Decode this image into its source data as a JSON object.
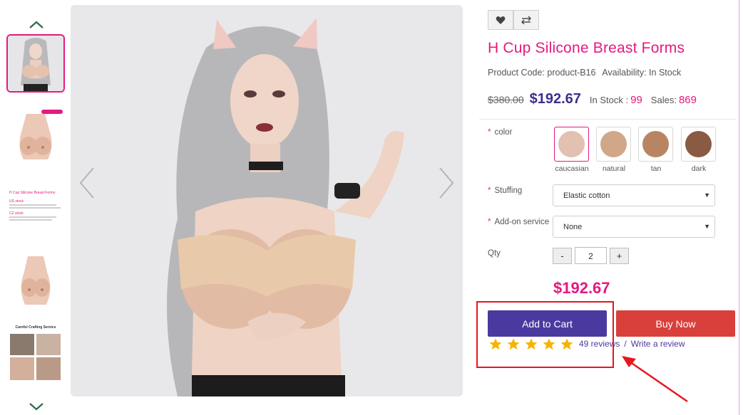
{
  "product": {
    "title": "H Cup Silicone Breast Forms",
    "code_text": "Product Code: product-B16",
    "availability_text": "Availability: In Stock",
    "old_price": "$380.00",
    "price": "$192.67",
    "stock_label": "In Stock :",
    "stock_value": "99",
    "sales_label": "Sales:",
    "sales_value": "869",
    "total_price": "$192.67"
  },
  "actions": {
    "wishlist_icon": "heart-icon",
    "compare_icon": "compare-arrows-icon"
  },
  "options": {
    "required_mark": "*",
    "color_label": "color",
    "colors": [
      {
        "name": "caucasian",
        "hex": "#e2c1b1"
      },
      {
        "name": "natural",
        "hex": "#d1a78a"
      },
      {
        "name": "tan",
        "hex": "#b88562"
      },
      {
        "name": "dark",
        "hex": "#8a5a42"
      }
    ],
    "stuffing_label": "Stuffing",
    "stuffing_value": "Elastic cotton",
    "addon_label": "Add-on service",
    "addon_value": "None",
    "caret": "▼",
    "qty_label": "Qty",
    "qty_value": "2",
    "qty_minus": "-",
    "qty_plus": "+"
  },
  "buttons": {
    "add_to_cart": "Add to Cart",
    "buy_now": "Buy Now"
  },
  "reviews": {
    "rating": 5,
    "count_text": "49 reviews",
    "separator": "/",
    "write_text": "Write a review"
  },
  "gallery": {
    "thumb3_title": "H Cup Silicone Breast Forms",
    "thumb3_us": "US stock",
    "thumb3_cz": "CZ stock",
    "thumb5_title": "Careful Crafting Service"
  },
  "colors": {
    "accent_pink": "#e5197e",
    "brand_purple": "#4a3aa0",
    "buy_red": "#d9403b",
    "annotation_red": "#e8161e"
  }
}
